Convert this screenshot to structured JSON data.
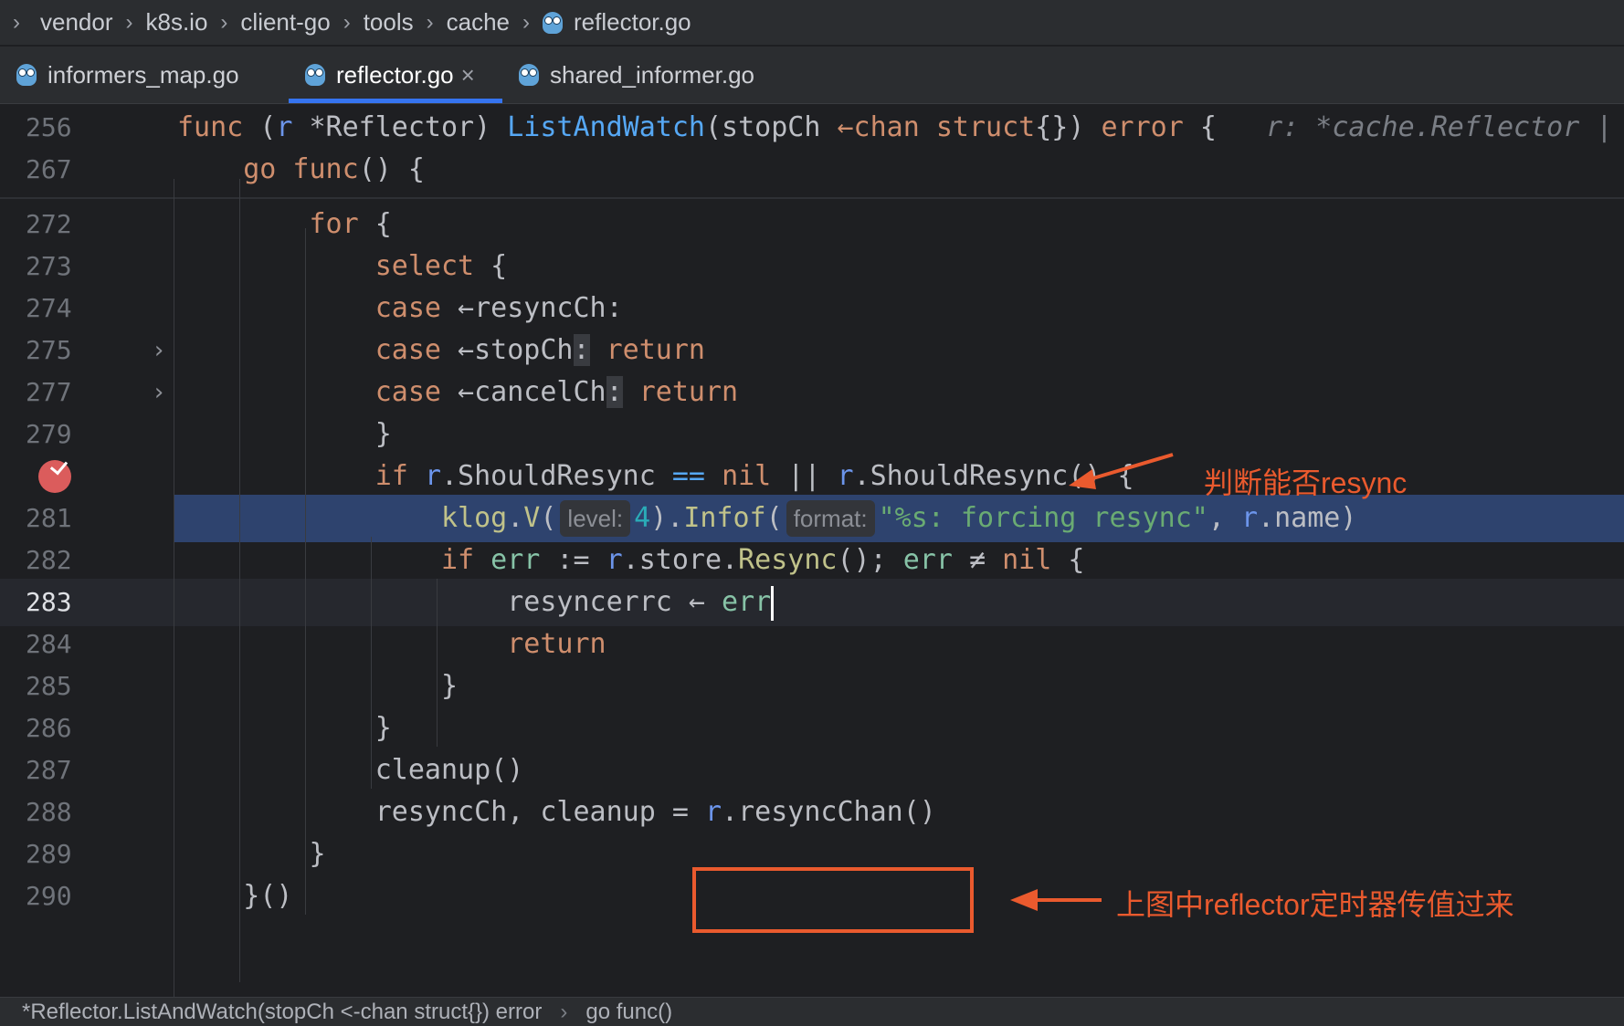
{
  "breadcrumb": [
    "vendor",
    "k8s.io",
    "client-go",
    "tools",
    "cache",
    "reflector.go"
  ],
  "tabs": [
    {
      "label": "informers_map.go",
      "icon": "go-gopher-icon"
    },
    {
      "label": "reflector.go",
      "icon": "go-gopher-icon",
      "active": true,
      "close": "×"
    },
    {
      "label": "shared_informer.go",
      "icon": "go-gopher-icon"
    }
  ],
  "editor": {
    "sticky_lines": [
      {
        "num": "256"
      },
      {
        "num": "267"
      }
    ],
    "sticky_hint": "r: *cache.Reflector |",
    "line_numbers": [
      "272",
      "273",
      "274",
      "275",
      "277",
      "279",
      "281",
      "282",
      "283",
      "284",
      "285",
      "286",
      "287",
      "288",
      "289",
      "290"
    ],
    "hints": {
      "level": "level:",
      "format": "format:"
    },
    "current_line": "283",
    "breakpoint_line": "280"
  },
  "annotations": {
    "top": "判断能否resync",
    "bottom": "上图中reflector定时器传值过来",
    "color": "#ea5a2e"
  },
  "status_bar": {
    "left": "*Reflector.ListAndWatch(stopCh <-chan struct{}) error",
    "right": "go func()"
  },
  "colors": {
    "keyword": "#cf8e6d",
    "function": "#56a8f5",
    "string": "#6aab73",
    "highlight": "#2e436e",
    "tab_accent": "#3574f0"
  }
}
